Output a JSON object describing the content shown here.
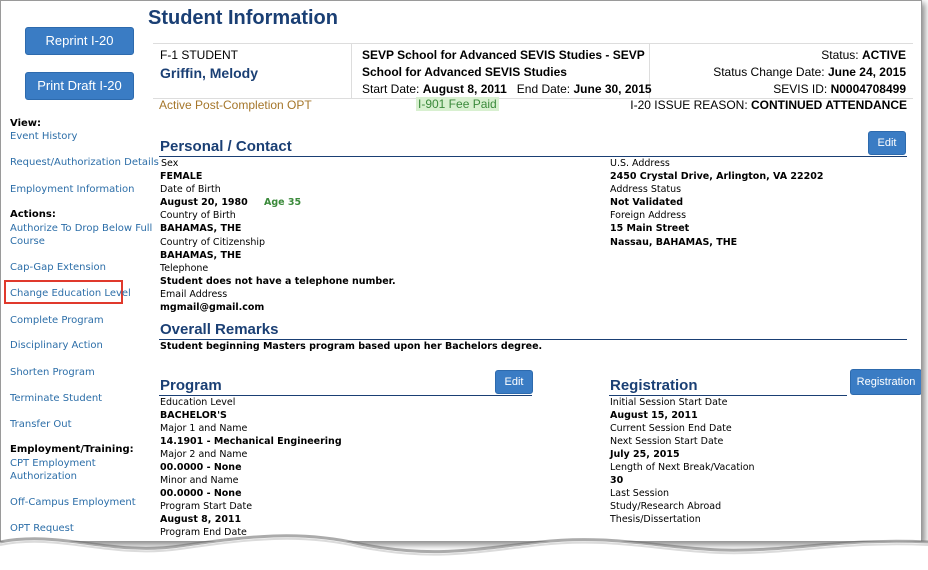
{
  "sidebar": {
    "reprint_label": "Reprint I-20",
    "print_draft_label": "Print Draft I-20",
    "view_heading": "View:",
    "view_links": [
      "Event History",
      "Request/Authorization Details",
      "Employment Information"
    ],
    "actions_heading": "Actions:",
    "action_links": [
      "Authorize To Drop Below Full",
      "Course",
      "Cap-Gap Extension",
      "Change Education Level",
      "Complete Program",
      "Disciplinary Action",
      "Shorten Program",
      "Terminate Student",
      "Transfer Out"
    ],
    "employment_heading": "Employment/Training:",
    "employment_links": [
      "CPT Employment",
      "Authorization",
      "Off-Campus Employment",
      "OPT Request"
    ]
  },
  "header": {
    "title": "Student Information",
    "student_type": "F-1 STUDENT",
    "student_name": "Griffin, Melody",
    "school_line1": "SEVP School for Advanced SEVIS Studies - SEVP",
    "school_line2": "School for Advanced SEVIS Studies",
    "start_label": "Start Date:",
    "start_value": "August 8, 2011",
    "end_label": "End Date:",
    "end_value": "June 30, 2015",
    "status_label": "Status:",
    "status_value": "ACTIVE",
    "status_change_label": "Status Change Date:",
    "status_change_value": "June 24, 2015",
    "sevis_label": "SEVIS ID:",
    "sevis_value": "N0004708499",
    "opt_status": "Active Post-Completion OPT",
    "fee_status": "I-901 Fee Paid",
    "issue_reason_label": "I-20 ISSUE REASON:",
    "issue_reason_value": "CONTINUED ATTENDANCE",
    "colors": {
      "title": "#1a3f74",
      "opt": "#a5762a",
      "fee_bg": "#d8f0d0",
      "fee_text": "#3b8a3b"
    }
  },
  "personal": {
    "heading": "Personal / Contact",
    "edit_label": "Edit",
    "sex_label": "Sex",
    "sex_value": "FEMALE",
    "dob_label": "Date of Birth",
    "dob_value": "August 20, 1980",
    "age": "Age 35",
    "cob_label": "Country of Birth",
    "cob_value": "BAHAMAS, THE",
    "coc_label": "Country of Citizenship",
    "coc_value": "BAHAMAS, THE",
    "phone_label": "Telephone",
    "phone_value": "Student does not have a telephone number.",
    "email_label": "Email Address",
    "email_value": "mgmail@gmail.com",
    "us_addr_label": "U.S. Address",
    "us_addr_value": "2450 Crystal Drive,  Arlington,  VA 22202",
    "addr_status_label": "Address Status",
    "addr_status_value": "Not Validated",
    "foreign_label": "Foreign Address",
    "foreign_line1": "15 Main Street",
    "foreign_line2": "Nassau,  BAHAMAS, THE"
  },
  "remarks": {
    "heading": "Overall Remarks",
    "text": "Student beginning Masters program based upon her Bachelors degree."
  },
  "program": {
    "heading": "Program",
    "edit_label": "Edit",
    "edu_label": "Education Level",
    "edu_value": "BACHELOR'S",
    "major1_label": "Major 1 and Name",
    "major1_value": "14.1901 - Mechanical Engineering",
    "major2_label": "Major 2 and Name",
    "major2_value": "00.0000 - None",
    "minor_label": "Minor and Name",
    "minor_value": "00.0000 - None",
    "start_label": "Program Start Date",
    "start_value": "August 8, 2011",
    "end_label": "Program End Date"
  },
  "registration": {
    "heading": "Registration",
    "button_label": "Registration",
    "init_label": "Initial Session Start Date",
    "init_value": "August 15, 2011",
    "cur_end_label": "Current Session End Date",
    "cur_end_value": "",
    "next_label": "Next Session Start Date",
    "next_value": "July 25, 2015",
    "break_label": "Length of Next Break/Vacation",
    "break_value": "30",
    "last_label": "Last Session",
    "study_label": "Study/Research Abroad",
    "thesis_label": "Thesis/Dissertation"
  }
}
